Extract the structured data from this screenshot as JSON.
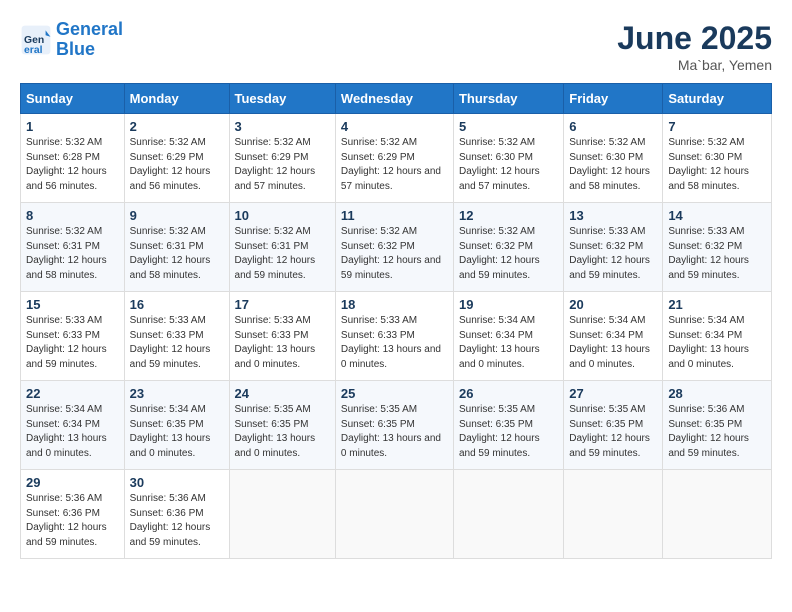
{
  "logo": {
    "line1": "General",
    "line2": "Blue"
  },
  "title": "June 2025",
  "location": "Ma`bar, Yemen",
  "weekdays": [
    "Sunday",
    "Monday",
    "Tuesday",
    "Wednesday",
    "Thursday",
    "Friday",
    "Saturday"
  ],
  "days": [
    {
      "num": "1",
      "sunrise": "5:32 AM",
      "sunset": "6:28 PM",
      "daylight": "12 hours and 56 minutes."
    },
    {
      "num": "2",
      "sunrise": "5:32 AM",
      "sunset": "6:29 PM",
      "daylight": "12 hours and 56 minutes."
    },
    {
      "num": "3",
      "sunrise": "5:32 AM",
      "sunset": "6:29 PM",
      "daylight": "12 hours and 57 minutes."
    },
    {
      "num": "4",
      "sunrise": "5:32 AM",
      "sunset": "6:29 PM",
      "daylight": "12 hours and 57 minutes."
    },
    {
      "num": "5",
      "sunrise": "5:32 AM",
      "sunset": "6:30 PM",
      "daylight": "12 hours and 57 minutes."
    },
    {
      "num": "6",
      "sunrise": "5:32 AM",
      "sunset": "6:30 PM",
      "daylight": "12 hours and 58 minutes."
    },
    {
      "num": "7",
      "sunrise": "5:32 AM",
      "sunset": "6:30 PM",
      "daylight": "12 hours and 58 minutes."
    },
    {
      "num": "8",
      "sunrise": "5:32 AM",
      "sunset": "6:31 PM",
      "daylight": "12 hours and 58 minutes."
    },
    {
      "num": "9",
      "sunrise": "5:32 AM",
      "sunset": "6:31 PM",
      "daylight": "12 hours and 58 minutes."
    },
    {
      "num": "10",
      "sunrise": "5:32 AM",
      "sunset": "6:31 PM",
      "daylight": "12 hours and 59 minutes."
    },
    {
      "num": "11",
      "sunrise": "5:32 AM",
      "sunset": "6:32 PM",
      "daylight": "12 hours and 59 minutes."
    },
    {
      "num": "12",
      "sunrise": "5:32 AM",
      "sunset": "6:32 PM",
      "daylight": "12 hours and 59 minutes."
    },
    {
      "num": "13",
      "sunrise": "5:33 AM",
      "sunset": "6:32 PM",
      "daylight": "12 hours and 59 minutes."
    },
    {
      "num": "14",
      "sunrise": "5:33 AM",
      "sunset": "6:32 PM",
      "daylight": "12 hours and 59 minutes."
    },
    {
      "num": "15",
      "sunrise": "5:33 AM",
      "sunset": "6:33 PM",
      "daylight": "12 hours and 59 minutes."
    },
    {
      "num": "16",
      "sunrise": "5:33 AM",
      "sunset": "6:33 PM",
      "daylight": "12 hours and 59 minutes."
    },
    {
      "num": "17",
      "sunrise": "5:33 AM",
      "sunset": "6:33 PM",
      "daylight": "13 hours and 0 minutes."
    },
    {
      "num": "18",
      "sunrise": "5:33 AM",
      "sunset": "6:33 PM",
      "daylight": "13 hours and 0 minutes."
    },
    {
      "num": "19",
      "sunrise": "5:34 AM",
      "sunset": "6:34 PM",
      "daylight": "13 hours and 0 minutes."
    },
    {
      "num": "20",
      "sunrise": "5:34 AM",
      "sunset": "6:34 PM",
      "daylight": "13 hours and 0 minutes."
    },
    {
      "num": "21",
      "sunrise": "5:34 AM",
      "sunset": "6:34 PM",
      "daylight": "13 hours and 0 minutes."
    },
    {
      "num": "22",
      "sunrise": "5:34 AM",
      "sunset": "6:34 PM",
      "daylight": "13 hours and 0 minutes."
    },
    {
      "num": "23",
      "sunrise": "5:34 AM",
      "sunset": "6:35 PM",
      "daylight": "13 hours and 0 minutes."
    },
    {
      "num": "24",
      "sunrise": "5:35 AM",
      "sunset": "6:35 PM",
      "daylight": "13 hours and 0 minutes."
    },
    {
      "num": "25",
      "sunrise": "5:35 AM",
      "sunset": "6:35 PM",
      "daylight": "13 hours and 0 minutes."
    },
    {
      "num": "26",
      "sunrise": "5:35 AM",
      "sunset": "6:35 PM",
      "daylight": "12 hours and 59 minutes."
    },
    {
      "num": "27",
      "sunrise": "5:35 AM",
      "sunset": "6:35 PM",
      "daylight": "12 hours and 59 minutes."
    },
    {
      "num": "28",
      "sunrise": "5:36 AM",
      "sunset": "6:35 PM",
      "daylight": "12 hours and 59 minutes."
    },
    {
      "num": "29",
      "sunrise": "5:36 AM",
      "sunset": "6:36 PM",
      "daylight": "12 hours and 59 minutes."
    },
    {
      "num": "30",
      "sunrise": "5:36 AM",
      "sunset": "6:36 PM",
      "daylight": "12 hours and 59 minutes."
    }
  ],
  "start_day": 0
}
